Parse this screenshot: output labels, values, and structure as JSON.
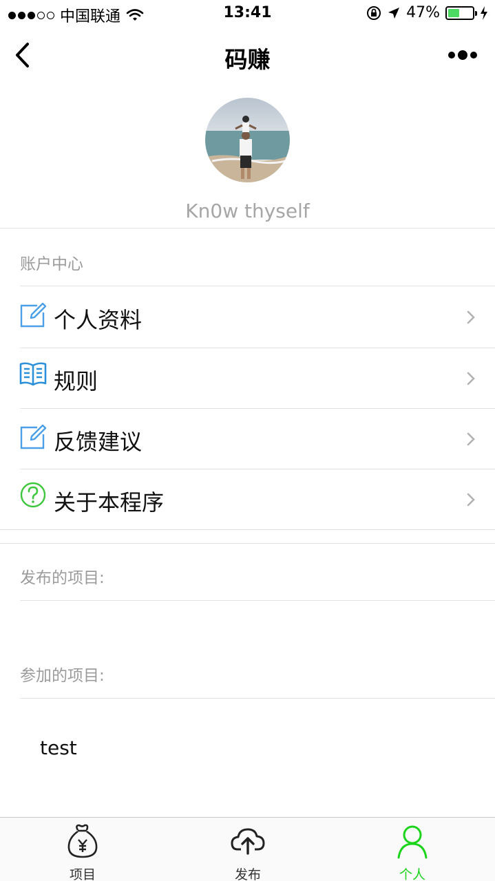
{
  "status_bar": {
    "carrier": "中国联通",
    "time": "13:41",
    "battery_percent": "47%",
    "battery_level": 0.47,
    "signal_bars": 3
  },
  "nav": {
    "title": "码赚",
    "back_icon": "chevron-left-icon",
    "more_icon": "more-dots-icon"
  },
  "profile": {
    "username": "Kn0w thyself"
  },
  "account_section": {
    "label": "账户中心",
    "items": [
      {
        "label": "个人资料",
        "icon": "edit-icon",
        "icon_color": "#4a9fe8"
      },
      {
        "label": "规则",
        "icon": "book-icon",
        "icon_color": "#2b8fd9"
      },
      {
        "label": "反馈建议",
        "icon": "edit-icon",
        "icon_color": "#4a9fe8"
      },
      {
        "label": "关于本程序",
        "icon": "help-icon",
        "icon_color": "#3dc73d"
      }
    ]
  },
  "published": {
    "label": "发布的项目:"
  },
  "joined": {
    "label": "参加的项目:",
    "items": [
      "test"
    ]
  },
  "tab_bar": {
    "tabs": [
      {
        "label": "项目",
        "icon": "money-bag-icon",
        "active": false
      },
      {
        "label": "发布",
        "icon": "cloud-upload-icon",
        "active": false
      },
      {
        "label": "个人",
        "icon": "person-icon",
        "active": true
      }
    ],
    "active_color": "#1bd41b"
  }
}
